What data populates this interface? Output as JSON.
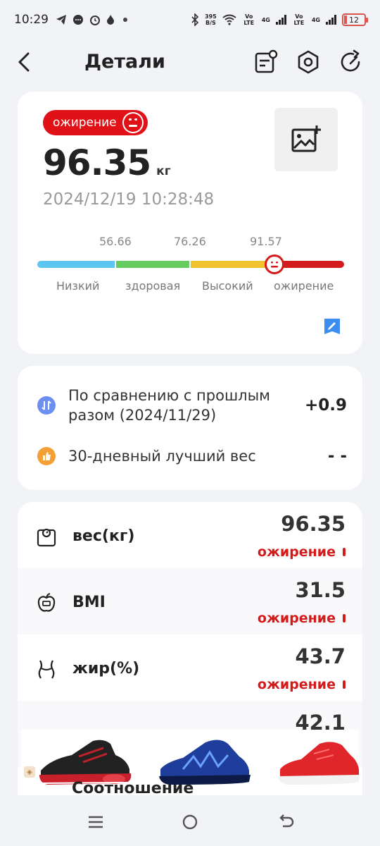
{
  "status_bar": {
    "time": "10:29",
    "net_speed_value": "395",
    "net_speed_unit": "B/S",
    "sim1_label": "Vo LTE",
    "sim1_gen": "4G",
    "sim2_label": "Vo LTE",
    "sim2_gen": "4G",
    "battery": "12",
    "notification_icons": [
      "telegram-icon",
      "chat-icon",
      "alarm-icon",
      "fire-icon",
      "dot-icon"
    ]
  },
  "header": {
    "title": "Детали",
    "icons": [
      "back-icon",
      "report-icon",
      "settings-hexagon-icon",
      "share-refresh-icon"
    ]
  },
  "summary": {
    "badge": "ожирение",
    "weight": "96.35",
    "unit": "кг",
    "datetime": "2024/12/19 10:28:48",
    "thresholds": [
      "56.66",
      "76.26",
      "91.57"
    ],
    "categories": [
      "Низкий",
      "здоровая",
      "Высокий",
      "ожирение"
    ],
    "scale_colors": [
      "#5cc5f0",
      "#66cc60",
      "#f2c12e",
      "#d41b1b"
    ]
  },
  "comparison": {
    "previous_label": "По сравнению с прошлым разом (2024/11/29)",
    "previous_label_line1": "По сравнению с прошлым",
    "previous_label_line2": "разом (2024/11/29)",
    "previous_value": "+0.9",
    "best_label": "30-дневный лучший вес",
    "best_value": "- -"
  },
  "metrics": [
    {
      "name": "вес(кг)",
      "value": "96.35",
      "status": "ожирение",
      "icon": "scale-icon"
    },
    {
      "name": "BMI",
      "value": "31.5",
      "status": "ожирение",
      "icon": "apple-icon"
    },
    {
      "name": "жир(%)",
      "value": "43.7",
      "status": "ожирение",
      "icon": "waist-icon"
    },
    {
      "name": "Соотношение",
      "value": "42.1",
      "status": "",
      "icon": "ratio-icon"
    }
  ],
  "ad": {
    "items": [
      "black-red-sneaker",
      "blue-sneaker",
      "red-sneaker"
    ]
  },
  "accent_red": "#e01218"
}
